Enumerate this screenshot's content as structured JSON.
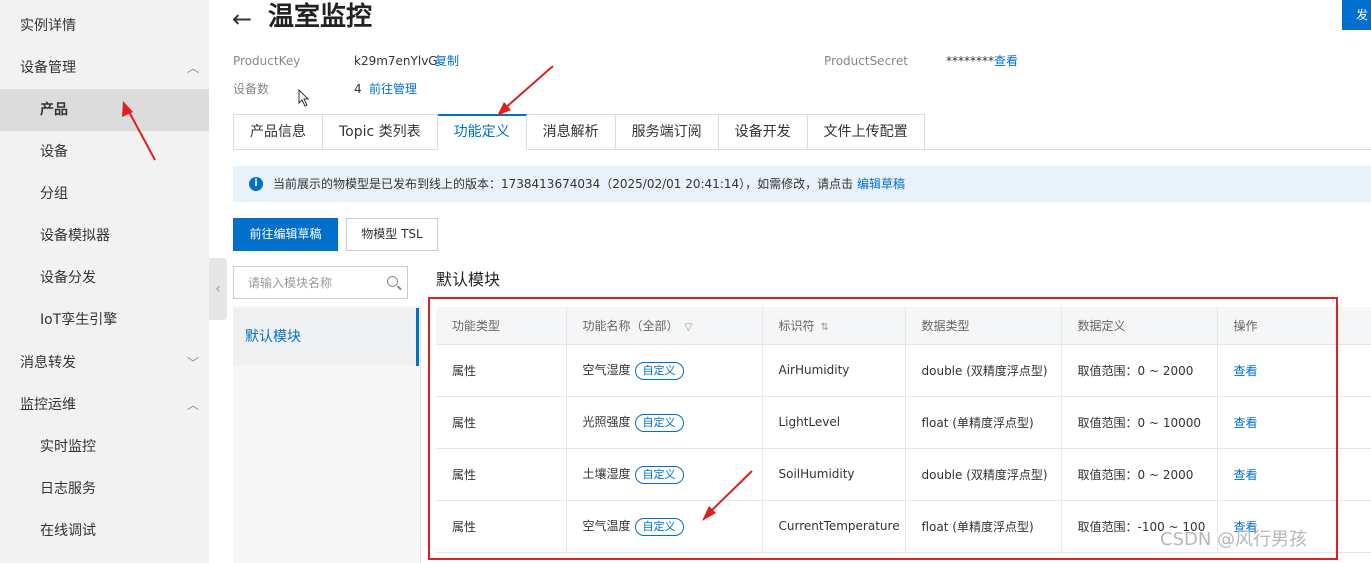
{
  "sidebar": {
    "items": [
      {
        "label": "实例详情",
        "level": "top"
      },
      {
        "label": "设备管理",
        "level": "top",
        "chevron": "up"
      },
      {
        "label": "产品",
        "level": "sub",
        "active": true
      },
      {
        "label": "设备",
        "level": "sub"
      },
      {
        "label": "分组",
        "level": "sub"
      },
      {
        "label": "设备模拟器",
        "level": "sub"
      },
      {
        "label": "设备分发",
        "level": "sub"
      },
      {
        "label": "IoT孪生引擎",
        "level": "sub"
      },
      {
        "label": "消息转发",
        "level": "top",
        "chevron": "down"
      },
      {
        "label": "监控运维",
        "level": "top",
        "chevron": "up"
      },
      {
        "label": "实时监控",
        "level": "sub"
      },
      {
        "label": "日志服务",
        "level": "sub"
      },
      {
        "label": "在线调试",
        "level": "sub"
      }
    ]
  },
  "header": {
    "title": "温室监控",
    "corner_button": "发"
  },
  "meta": {
    "product_key_label": "ProductKey",
    "product_key_value": "k29m7enYlvG",
    "copy_link": "复制",
    "product_secret_label": "ProductSecret",
    "product_secret_value": "********",
    "view_link": "查看",
    "device_count_label": "设备数",
    "device_count_value": "4",
    "manage_link": "前往管理"
  },
  "tabs": [
    {
      "label": "产品信息"
    },
    {
      "label": "Topic 类列表"
    },
    {
      "label": "功能定义",
      "active": true
    },
    {
      "label": "消息解析"
    },
    {
      "label": "服务端订阅"
    },
    {
      "label": "设备开发"
    },
    {
      "label": "文件上传配置"
    }
  ],
  "info": {
    "text": "当前展示的物模型是已发布到线上的版本：1738413674034（2025/02/01 20:41:14），如需修改，请点击",
    "link": "编辑草稿"
  },
  "buttons": {
    "edit_draft": "前往编辑草稿",
    "tsl": "物模型 TSL"
  },
  "module": {
    "search_placeholder": "请输入模块名称",
    "items": [
      "默认模块"
    ],
    "heading": "默认模块"
  },
  "table": {
    "headers": [
      "功能类型",
      "功能名称（全部）",
      "标识符",
      "数据类型",
      "数据定义",
      "操作"
    ],
    "rows": [
      {
        "type": "属性",
        "name": "空气湿度",
        "badge": "自定义",
        "identifier": "AirHumidity",
        "datatype": "double (双精度浮点型)",
        "definition": "取值范围：0 ~ 2000",
        "action": "查看"
      },
      {
        "type": "属性",
        "name": "光照强度",
        "badge": "自定义",
        "identifier": "LightLevel",
        "datatype": "float (单精度浮点型)",
        "definition": "取值范围：0 ~ 10000",
        "action": "查看"
      },
      {
        "type": "属性",
        "name": "土壤湿度",
        "badge": "自定义",
        "identifier": "SoilHumidity",
        "datatype": "double (双精度浮点型)",
        "definition": "取值范围：0 ~ 2000",
        "action": "查看"
      },
      {
        "type": "属性",
        "name": "空气温度",
        "badge": "自定义",
        "identifier": "CurrentTemperature",
        "datatype": "float (单精度浮点型)",
        "definition": "取值范围：-100 ~ 100",
        "action": "查看"
      }
    ]
  },
  "watermark": "CSDN @风行男孩",
  "colors": {
    "primary": "#0070cc",
    "annotation": "#e02020",
    "sidebar_bg": "#f2f2f2"
  }
}
